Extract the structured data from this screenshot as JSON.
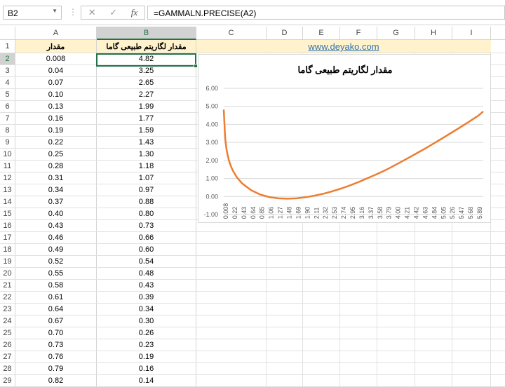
{
  "name_box": "B2",
  "formula": "=GAMMALN.PRECISE(A2)",
  "columns": [
    "A",
    "B",
    "C",
    "D",
    "E",
    "F",
    "G",
    "H",
    "I"
  ],
  "link": "www.deyako.com",
  "headers": {
    "a": "مقدار",
    "b": "مقدار لگاریتم طبیعی گاما"
  },
  "rows": [
    [
      "0.008",
      "4.82"
    ],
    [
      "0.04",
      "3.25"
    ],
    [
      "0.07",
      "2.65"
    ],
    [
      "0.10",
      "2.27"
    ],
    [
      "0.13",
      "1.99"
    ],
    [
      "0.16",
      "1.77"
    ],
    [
      "0.19",
      "1.59"
    ],
    [
      "0.22",
      "1.43"
    ],
    [
      "0.25",
      "1.30"
    ],
    [
      "0.28",
      "1.18"
    ],
    [
      "0.31",
      "1.07"
    ],
    [
      "0.34",
      "0.97"
    ],
    [
      "0.37",
      "0.88"
    ],
    [
      "0.40",
      "0.80"
    ],
    [
      "0.43",
      "0.73"
    ],
    [
      "0.46",
      "0.66"
    ],
    [
      "0.49",
      "0.60"
    ],
    [
      "0.52",
      "0.54"
    ],
    [
      "0.55",
      "0.48"
    ],
    [
      "0.58",
      "0.43"
    ],
    [
      "0.61",
      "0.39"
    ],
    [
      "0.64",
      "0.34"
    ],
    [
      "0.67",
      "0.30"
    ],
    [
      "0.70",
      "0.26"
    ],
    [
      "0.73",
      "0.23"
    ],
    [
      "0.76",
      "0.19"
    ],
    [
      "0.79",
      "0.16"
    ],
    [
      "0.82",
      "0.14"
    ]
  ],
  "chart_data": {
    "type": "line",
    "title": "مقدار لگاریتم طبیعی گاما",
    "ylim": [
      -1,
      6
    ],
    "yticks": [
      "-1.00",
      "0.00",
      "1.00",
      "2.00",
      "3.00",
      "4.00",
      "5.00",
      "6.00"
    ],
    "xticks": [
      "0.008",
      "0.22",
      "0.43",
      "0.64",
      "0.85",
      "1.06",
      "1.27",
      "1.48",
      "1.69",
      "1.90",
      "2.11",
      "2.32",
      "2.53",
      "2.74",
      "2.95",
      "3.16",
      "3.37",
      "3.58",
      "3.79",
      "4.00",
      "4.21",
      "4.42",
      "4.63",
      "4.84",
      "5.05",
      "5.26",
      "5.47",
      "5.68",
      "5.89"
    ],
    "x": [
      0.008,
      0.04,
      0.07,
      0.1,
      0.13,
      0.16,
      0.19,
      0.22,
      0.31,
      0.43,
      0.64,
      0.85,
      1.06,
      1.27,
      1.48,
      1.69,
      1.9,
      2.11,
      2.32,
      2.53,
      2.74,
      2.95,
      3.16,
      3.37,
      3.58,
      3.79,
      4.0,
      4.21,
      4.42,
      4.63,
      4.84,
      5.05,
      5.26,
      5.47,
      5.68,
      5.89,
      6.0
    ],
    "y": [
      4.82,
      3.25,
      2.65,
      2.27,
      1.99,
      1.77,
      1.59,
      1.43,
      1.07,
      0.73,
      0.35,
      0.11,
      -0.03,
      -0.1,
      -0.12,
      -0.1,
      -0.04,
      0.05,
      0.16,
      0.3,
      0.46,
      0.64,
      0.84,
      1.06,
      1.28,
      1.52,
      1.79,
      2.06,
      2.34,
      2.62,
      2.92,
      3.22,
      3.53,
      3.84,
      4.16,
      4.49,
      4.72
    ],
    "color": "#ed7d31",
    "grid": true
  }
}
